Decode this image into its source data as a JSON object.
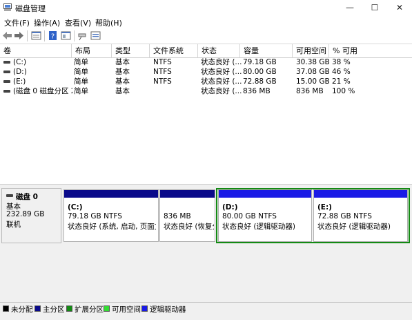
{
  "window": {
    "title": "磁盘管理",
    "minimize": "—",
    "maximize": "☐",
    "close": "✕"
  },
  "menu": [
    "文件(F)",
    "操作(A)",
    "查看(V)",
    "帮助(H)"
  ],
  "toolbar_icons": [
    "back-icon",
    "forward-icon",
    "volume-list-icon",
    "help-icon",
    "properties-icon",
    "rescan-icon",
    "settings-icon"
  ],
  "columns": [
    "卷",
    "布局",
    "类型",
    "文件系统",
    "状态",
    "容量",
    "可用空间",
    "% 可用"
  ],
  "volumes": [
    {
      "name": "(C:)",
      "layout": "简单",
      "type": "基本",
      "fs": "NTFS",
      "status": "状态良好 (...",
      "capacity": "79.18 GB",
      "free": "30.38 GB",
      "pct": "38 %"
    },
    {
      "name": "(D:)",
      "layout": "简单",
      "type": "基本",
      "fs": "NTFS",
      "status": "状态良好 (...",
      "capacity": "80.00 GB",
      "free": "37.08 GB",
      "pct": "46 %"
    },
    {
      "name": "(E:)",
      "layout": "简单",
      "type": "基本",
      "fs": "NTFS",
      "status": "状态良好 (...",
      "capacity": "72.88 GB",
      "free": "15.00 GB",
      "pct": "21 %"
    },
    {
      "name": "(磁盘 0 磁盘分区 2)",
      "layout": "简单",
      "type": "基本",
      "fs": "",
      "status": "状态良好 (...",
      "capacity": "836 MB",
      "free": "836 MB",
      "pct": "100 %"
    }
  ],
  "disk": {
    "name": "磁盘 0",
    "type": "基本",
    "size": "232.89 GB",
    "state": "联机"
  },
  "partitions": [
    {
      "label": "(C:)",
      "size": "79.18 GB NTFS",
      "status": "状态良好 (系统, 启动, 页面文件"
    },
    {
      "label": "",
      "size": "836 MB",
      "status": "状态良好 (恢复分"
    },
    {
      "label": "(D:)",
      "size": "80.00 GB NTFS",
      "status": "状态良好 (逻辑驱动器)"
    },
    {
      "label": "(E:)",
      "size": "72.88 GB NTFS",
      "status": "状态良好 (逻辑驱动器)"
    }
  ],
  "legend": [
    {
      "label": "未分配",
      "color": "#000000"
    },
    {
      "label": "主分区",
      "color": "#0a0a8a"
    },
    {
      "label": "扩展分区",
      "color": "#138a13"
    },
    {
      "label": "可用空间",
      "color": "#33dd33"
    },
    {
      "label": "逻辑驱动器",
      "color": "#1a1ae6"
    }
  ]
}
